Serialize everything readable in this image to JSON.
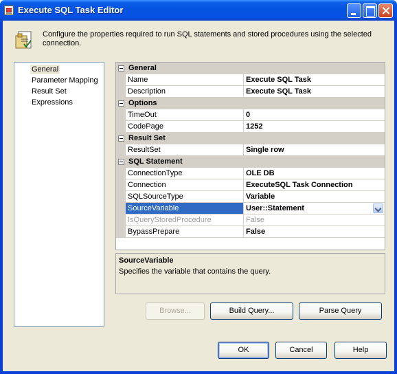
{
  "window": {
    "title": "Execute SQL Task Editor"
  },
  "header": {
    "text": "Configure the properties required to run SQL statements and stored procedures using the selected connection."
  },
  "nav": {
    "items": [
      {
        "label": "General",
        "selected": true
      },
      {
        "label": "Parameter Mapping"
      },
      {
        "label": "Result Set"
      },
      {
        "label": "Expressions"
      }
    ]
  },
  "grid": {
    "categories": {
      "general": "General",
      "options": "Options",
      "result_set": "Result Set",
      "sql_statement": "SQL Statement"
    },
    "props": {
      "name": {
        "name": "Name",
        "value": "Execute SQL Task"
      },
      "description": {
        "name": "Description",
        "value": "Execute SQL Task"
      },
      "timeout": {
        "name": "TimeOut",
        "value": "0"
      },
      "codepage": {
        "name": "CodePage",
        "value": "1252"
      },
      "resultset": {
        "name": "ResultSet",
        "value": "Single row"
      },
      "connectiontype": {
        "name": "ConnectionType",
        "value": "OLE DB"
      },
      "connection": {
        "name": "Connection",
        "value": "ExecuteSQL Task Connection"
      },
      "sqlsourcetype": {
        "name": "SQLSourceType",
        "value": "Variable"
      },
      "sourcevariable": {
        "name": "SourceVariable",
        "value": "User::Statement"
      },
      "isquerystoredprocedure": {
        "name": "IsQueryStoredProcedure",
        "value": "False"
      },
      "bypassprepare": {
        "name": "BypassPrepare",
        "value": "False"
      }
    }
  },
  "description_panel": {
    "title": "SourceVariable",
    "text": "Specifies the variable that contains the query."
  },
  "buttons": {
    "browse": "Browse...",
    "build_query": "Build Query...",
    "parse_query": "Parse Query",
    "ok": "OK",
    "cancel": "Cancel",
    "help": "Help"
  },
  "colors": {
    "titlebar": "#0553e0",
    "selection": "#316ac5",
    "dialog_bg": "#ece9d8"
  }
}
